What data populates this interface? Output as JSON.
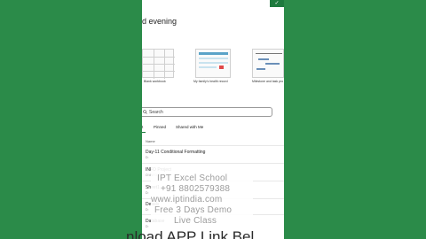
{
  "greeting": "d evening",
  "templates": [
    {
      "label": "Blank workbook"
    },
    {
      "label": "My family's health record"
    },
    {
      "label": "Milestone and task pro"
    }
  ],
  "search": {
    "placeholder": "Search"
  },
  "tabs": [
    {
      "label": "t"
    },
    {
      "label": "Pinned"
    },
    {
      "label": "Shared with Me"
    }
  ],
  "list_header": {
    "name": "Name"
  },
  "files": [
    {
      "name": "Day-11 Conditional Formatting",
      "meta": "D:"
    },
    {
      "name": "INFO Project",
      "meta": "O:\\INFO Project"
    },
    {
      "name": "Sheet1",
      "meta": "D:"
    },
    {
      "name": "Details",
      "meta": "D:"
    },
    {
      "name": "Database",
      "meta": "D:"
    }
  ],
  "watermark": {
    "line1": "IPT Excel School",
    "line2": "+91 8802579388",
    "line3": "www.iptindia.com",
    "line4": "Free 3 Days Demo",
    "line5": "Live Class"
  },
  "bottom_banner": "nload APP Link Bel",
  "colors": {
    "background_green": "#2b8b49",
    "accent_green": "#1e7a3e"
  }
}
